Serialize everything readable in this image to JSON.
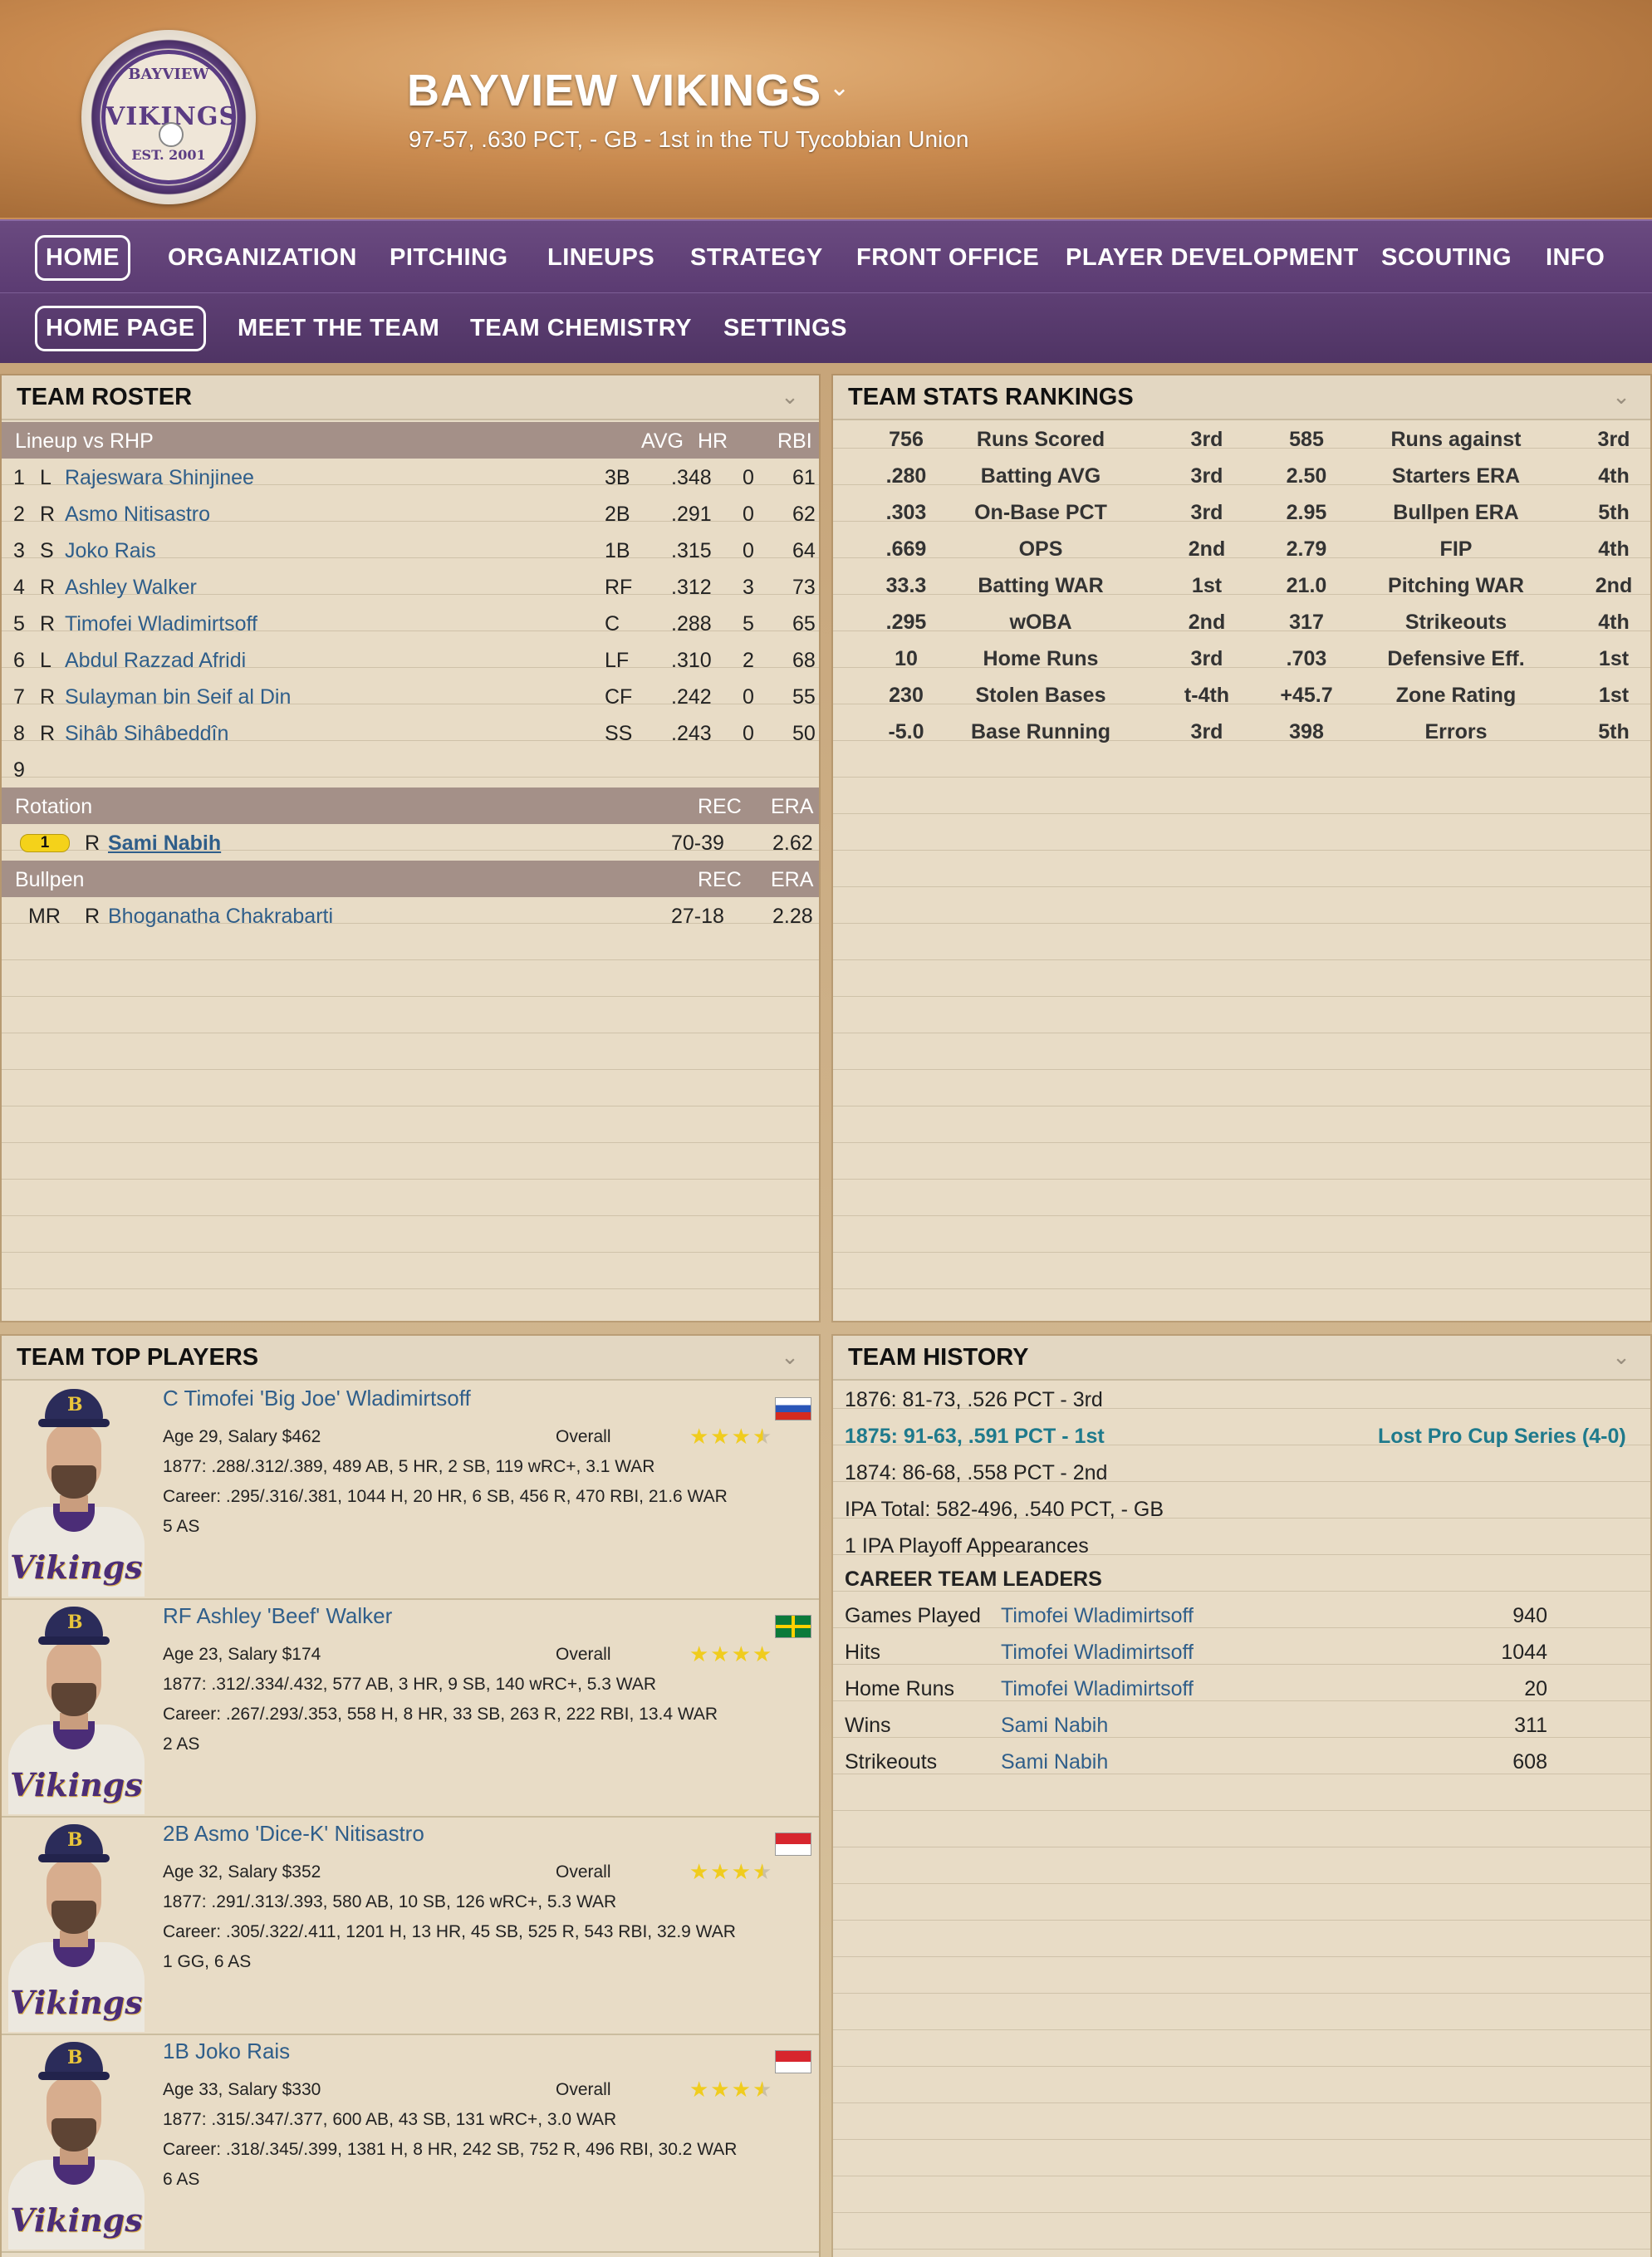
{
  "header": {
    "logo": {
      "top": "BAYVIEW",
      "word": "VIKINGS",
      "bottom": "EST. 2001"
    },
    "team_name": "BAYVIEW VIKINGS",
    "record_line": "97-57, .630 PCT, - GB - 1st in the TU Tycobbian Union"
  },
  "nav_primary": [
    "HOME",
    "ORGANIZATION",
    "PITCHING",
    "LINEUPS",
    "STRATEGY",
    "FRONT OFFICE",
    "PLAYER DEVELOPMENT",
    "SCOUTING",
    "INFO"
  ],
  "nav_secondary": [
    "HOME PAGE",
    "MEET THE TEAM",
    "TEAM CHEMISTRY",
    "SETTINGS"
  ],
  "roster": {
    "title": "TEAM ROSTER",
    "lineup_header": {
      "label": "Lineup vs RHP",
      "avg": "AVG",
      "hr": "HR",
      "rbi": "RBI"
    },
    "lineup": [
      {
        "n": "1",
        "hand": "L",
        "name": "Rajeswara Shinjinee",
        "pos": "3B",
        "avg": ".348",
        "hr": "0",
        "rbi": "61"
      },
      {
        "n": "2",
        "hand": "R",
        "name": "Asmo Nitisastro",
        "pos": "2B",
        "avg": ".291",
        "hr": "0",
        "rbi": "62"
      },
      {
        "n": "3",
        "hand": "S",
        "name": "Joko Rais",
        "pos": "1B",
        "avg": ".315",
        "hr": "0",
        "rbi": "64"
      },
      {
        "n": "4",
        "hand": "R",
        "name": "Ashley Walker",
        "pos": "RF",
        "avg": ".312",
        "hr": "3",
        "rbi": "73"
      },
      {
        "n": "5",
        "hand": "R",
        "name": "Timofei Wladimirtsoff",
        "pos": "C",
        "avg": ".288",
        "hr": "5",
        "rbi": "65"
      },
      {
        "n": "6",
        "hand": "L",
        "name": "Abdul Razzad Afridi",
        "pos": "LF",
        "avg": ".310",
        "hr": "2",
        "rbi": "68"
      },
      {
        "n": "7",
        "hand": "R",
        "name": "Sulayman bin Seif al Din",
        "pos": "CF",
        "avg": ".242",
        "hr": "0",
        "rbi": "55"
      },
      {
        "n": "8",
        "hand": "R",
        "name": "Sihâb Sihâbeddîn",
        "pos": "SS",
        "avg": ".243",
        "hr": "0",
        "rbi": "50"
      },
      {
        "n": "9",
        "hand": "",
        "name": "",
        "pos": "",
        "avg": "",
        "hr": "",
        "rbi": ""
      }
    ],
    "rotation_header": {
      "label": "Rotation",
      "rec": "REC",
      "era": "ERA"
    },
    "rotation": [
      {
        "badge": "1",
        "hand": "R",
        "name": "Sami Nabih",
        "rec": "70-39",
        "era": "2.62"
      }
    ],
    "bullpen_header": {
      "label": "Bullpen",
      "rec": "REC",
      "era": "ERA"
    },
    "bullpen": [
      {
        "role": "MR",
        "hand": "R",
        "name": "Bhoganatha Chakrabarti",
        "rec": "27-18",
        "era": "2.28"
      }
    ]
  },
  "rankings": {
    "title": "TEAM STATS RANKINGS",
    "rows": [
      {
        "v1": "756",
        "l1": "Runs Scored",
        "r1": "3rd",
        "v2": "585",
        "l2": "Runs against",
        "r2": "3rd"
      },
      {
        "v1": ".280",
        "l1": "Batting AVG",
        "r1": "3rd",
        "v2": "2.50",
        "l2": "Starters ERA",
        "r2": "4th"
      },
      {
        "v1": ".303",
        "l1": "On-Base PCT",
        "r1": "3rd",
        "v2": "2.95",
        "l2": "Bullpen ERA",
        "r2": "5th"
      },
      {
        "v1": ".669",
        "l1": "OPS",
        "r1": "2nd",
        "v2": "2.79",
        "l2": "FIP",
        "r2": "4th"
      },
      {
        "v1": "33.3",
        "l1": "Batting WAR",
        "r1": "1st",
        "v2": "21.0",
        "l2": "Pitching WAR",
        "r2": "2nd"
      },
      {
        "v1": ".295",
        "l1": "wOBA",
        "r1": "2nd",
        "v2": "317",
        "l2": "Strikeouts",
        "r2": "4th"
      },
      {
        "v1": "10",
        "l1": "Home Runs",
        "r1": "3rd",
        "v2": ".703",
        "l2": "Defensive Eff.",
        "r2": "1st"
      },
      {
        "v1": "230",
        "l1": "Stolen Bases",
        "r1": "t-4th",
        "v2": "+45.7",
        "l2": "Zone Rating",
        "r2": "1st"
      },
      {
        "v1": "-5.0",
        "l1": "Base Running",
        "r1": "3rd",
        "v2": "398",
        "l2": "Errors",
        "r2": "5th"
      }
    ]
  },
  "top_players": {
    "title": "TEAM TOP PLAYERS",
    "overall_label": "Overall",
    "players": [
      {
        "name": "C Timofei 'Big Joe' Wladimirtsoff",
        "age_salary": "Age 29, Salary $462",
        "line1": "1877: .288/.312/.389, 489 AB, 5 HR, 2 SB, 119 wRC+, 3.1 WAR",
        "line2": "Career: .295/.316/.381, 1044 H, 20 HR, 6 SB, 456 R, 470 RBI, 21.6 WAR",
        "awards": "5 AS",
        "stars": 3.5,
        "flag": "russia",
        "jersey": "Vikings"
      },
      {
        "name": "RF Ashley 'Beef' Walker",
        "age_salary": "Age 23, Salary $174",
        "line1": "1877: .312/.334/.432, 577 AB, 3 HR, 9 SB, 140 wRC+, 5.3 WAR",
        "line2": "Career: .267/.293/.353, 558 H, 8 HR, 33 SB, 263 R, 222 RBI, 13.4 WAR",
        "awards": "2 AS",
        "stars": 4,
        "flag": "dominica",
        "jersey": "Vikings"
      },
      {
        "name": "2B Asmo 'Dice-K' Nitisastro",
        "age_salary": "Age 32, Salary $352",
        "line1": "1877: .291/.313/.393, 580 AB, 10 SB, 126 wRC+, 5.3 WAR",
        "line2": "Career: .305/.322/.411, 1201 H, 13 HR, 45 SB, 525 R, 543 RBI, 32.9 WAR",
        "awards": "1 GG, 6 AS",
        "stars": 3.5,
        "flag": "indonesia",
        "jersey": "Vikings"
      },
      {
        "name": "1B Joko Rais",
        "age_salary": "Age 33, Salary $330",
        "line1": "1877: .315/.347/.377, 600 AB, 43 SB, 131 wRC+, 3.0 WAR",
        "line2": "Career: .318/.345/.399, 1381 H, 8 HR, 242 SB, 752 R, 496 RBI, 30.2 WAR",
        "awards": "6 AS",
        "stars": 3.5,
        "flag": "indonesia",
        "jersey": "Vikings"
      }
    ]
  },
  "history": {
    "title": "TEAM HISTORY",
    "seasons": [
      {
        "text": "1876: 81-73, .526 PCT - 3rd",
        "highlight": false,
        "note": ""
      },
      {
        "text": "1875: 91-63, .591 PCT - 1st",
        "highlight": true,
        "note": "Lost Pro Cup Series (4-0)"
      },
      {
        "text": "1874: 86-68, .558 PCT - 2nd",
        "highlight": false,
        "note": ""
      }
    ],
    "ipa_total": "IPA Total: 582-496, .540 PCT, - GB",
    "playoffs": "1 IPA Playoff Appearances",
    "leaders_title": "CAREER TEAM LEADERS",
    "leaders": [
      {
        "cat": "Games Played",
        "name": "Timofei Wladimirtsoff",
        "val": "940"
      },
      {
        "cat": "Hits",
        "name": "Timofei Wladimirtsoff",
        "val": "1044"
      },
      {
        "cat": "Home Runs",
        "name": "Timofei Wladimirtsoff",
        "val": "20"
      },
      {
        "cat": "Wins",
        "name": "Sami Nabih",
        "val": "311"
      },
      {
        "cat": "Strikeouts",
        "name": "Sami Nabih",
        "val": "608"
      }
    ]
  },
  "colors": {
    "accent": "#5b3b72",
    "link": "#2f5e8a",
    "header_row": "#a49088",
    "star": "#f0cc1e",
    "history_highlight": "#1f7a8c"
  }
}
